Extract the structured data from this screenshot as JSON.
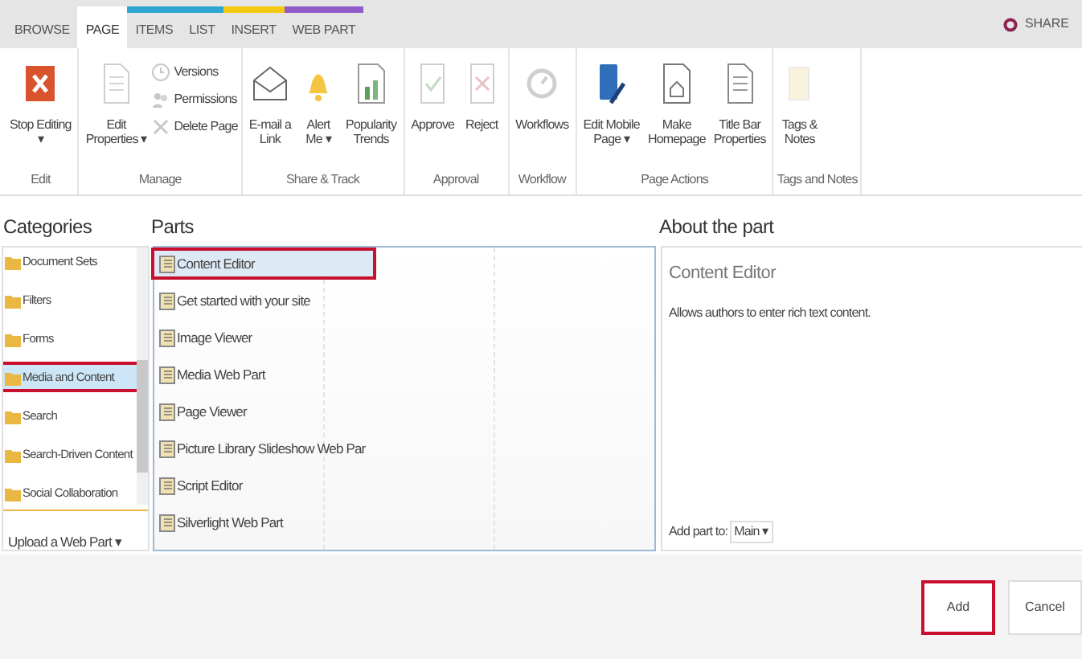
{
  "tabs": [
    {
      "label": "BROWSE",
      "selected": false,
      "color": "#e5e5e5"
    },
    {
      "label": "PAGE",
      "selected": true,
      "color": "#ffffff"
    },
    {
      "label": "ITEMS",
      "selected": false,
      "color": "#2ea6cf"
    },
    {
      "label": "LIST",
      "selected": false,
      "color": "#2ea6cf"
    },
    {
      "label": "INSERT",
      "selected": false,
      "color": "#f2c811"
    },
    {
      "label": "WEB PART",
      "selected": false,
      "color": "#8e5bc8"
    }
  ],
  "share": "SHARE",
  "ribbon_groups": [
    {
      "label": "Edit",
      "buttons": [
        {
          "kind": "large",
          "label": "Stop Editing\n▾",
          "disabled": false
        }
      ]
    },
    {
      "label": "Manage",
      "buttons": [
        {
          "kind": "large",
          "label": "Edit\nProperties ▾",
          "disabled": true
        },
        {
          "kind": "small",
          "label": "Versions",
          "disabled": true
        },
        {
          "kind": "small",
          "label": "Permissions",
          "disabled": true
        },
        {
          "kind": "small",
          "label": "Delete Page",
          "disabled": true
        }
      ]
    },
    {
      "label": "Share & Track",
      "buttons": [
        {
          "kind": "large",
          "label": "E-mail a\nLink",
          "disabled": false
        },
        {
          "kind": "large",
          "label": "Alert\nMe ▾",
          "disabled": false
        },
        {
          "kind": "large",
          "label": "Popularity\nTrends",
          "disabled": false
        }
      ]
    },
    {
      "label": "Approval",
      "buttons": [
        {
          "kind": "large",
          "label": "Approve",
          "disabled": true
        },
        {
          "kind": "large",
          "label": "Reject",
          "disabled": true
        }
      ]
    },
    {
      "label": "Workflow",
      "buttons": [
        {
          "kind": "large",
          "label": "Workflows",
          "disabled": true
        }
      ]
    },
    {
      "label": "Page Actions",
      "buttons": [
        {
          "kind": "large",
          "label": "Edit Mobile\nPage ▾",
          "disabled": false
        },
        {
          "kind": "large",
          "label": "Make\nHomepage",
          "disabled": false
        },
        {
          "kind": "large",
          "label": "Title Bar\nProperties",
          "disabled": false
        }
      ]
    },
    {
      "label": "Tags and Notes",
      "buttons": [
        {
          "kind": "large",
          "label": "Tags &\nNotes",
          "disabled": true
        }
      ]
    }
  ],
  "categories": {
    "title": "Categories",
    "items": [
      {
        "label": "Document Sets",
        "selected": false,
        "highlighted": false
      },
      {
        "label": "Filters",
        "selected": false,
        "highlighted": false
      },
      {
        "label": "Forms",
        "selected": false,
        "highlighted": false
      },
      {
        "label": "Media and Content",
        "selected": true,
        "highlighted": true
      },
      {
        "label": "Search",
        "selected": false,
        "highlighted": false
      },
      {
        "label": "Search-Driven Content",
        "selected": false,
        "highlighted": false
      },
      {
        "label": "Social Collaboration",
        "selected": false,
        "highlighted": false
      }
    ],
    "upload": "Upload a Web Part ▾"
  },
  "parts": {
    "title": "Parts",
    "items": [
      {
        "label": "Content Editor",
        "selected": true,
        "highlighted": true
      },
      {
        "label": "Get started with your site",
        "selected": false,
        "highlighted": false
      },
      {
        "label": "Image Viewer",
        "selected": false,
        "highlighted": false
      },
      {
        "label": "Media Web Part",
        "selected": false,
        "highlighted": false
      },
      {
        "label": "Page Viewer",
        "selected": false,
        "highlighted": false
      },
      {
        "label": "Picture Library Slideshow Web Par",
        "selected": false,
        "highlighted": false
      },
      {
        "label": "Script Editor",
        "selected": false,
        "highlighted": false
      },
      {
        "label": "Silverlight Web Part",
        "selected": false,
        "highlighted": false
      }
    ]
  },
  "about": {
    "title": "About the part",
    "name": "Content Editor",
    "description": "Allows authors to enter rich text content.",
    "add_to_label": "Add part to:",
    "add_to_value": "Main ▾"
  },
  "buttons": [
    {
      "label": "Add",
      "highlighted": true
    },
    {
      "label": "Cancel",
      "highlighted": false
    }
  ]
}
